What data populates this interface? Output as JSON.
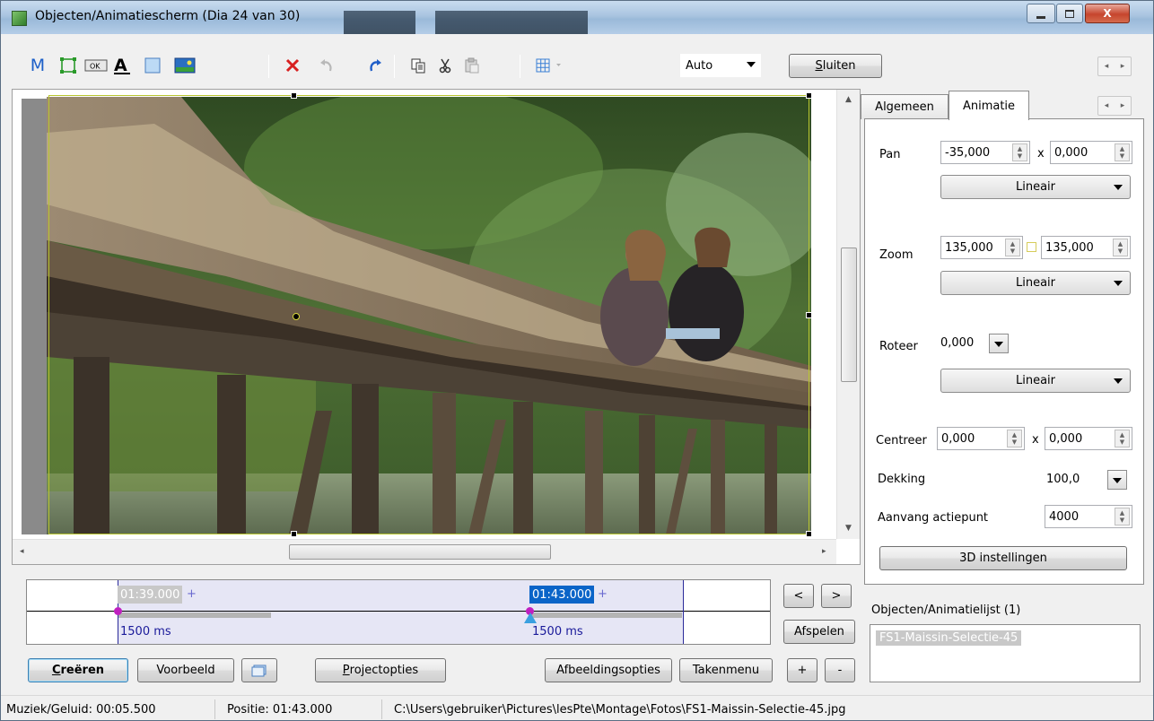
{
  "window": {
    "title": "Objecten/Animatiescherm  (Dia 24 van 30)",
    "min_icon": "minimize-icon",
    "max_icon": "maximize-icon",
    "close_icon": "close-icon",
    "close_symbol": "X"
  },
  "toolbar": {
    "m_label": "M",
    "mode_value": "Auto",
    "close_button": "Sluiten",
    "close_accel": "S",
    "close_rest": "luiten"
  },
  "canvas": {
    "image_description": "photo"
  },
  "timeline": {
    "key1_time": "01:39.000",
    "key2_time": "01:43.000",
    "plus": "+",
    "key1_ms": "1500 ms",
    "key2_ms": "1500 ms"
  },
  "buttons": {
    "prev": "<",
    "next": ">",
    "play": "Afspelen",
    "add": "+",
    "remove": "-",
    "create_accel": "C",
    "create_rest": "reëren",
    "preview": "Voorbeeld",
    "project_accel": "P",
    "project_rest": "rojectopties",
    "image_options": "Afbeeldingsopties",
    "task_menu": "Takenmenu"
  },
  "tabs": {
    "general": "Algemeen",
    "animation": "Animatie"
  },
  "animation_panel": {
    "pan_label": "Pan",
    "pan_x": "-35,000",
    "pan_y": "0,000",
    "x_sep": "x",
    "pan_interp": "Lineair",
    "zoom_label": "Zoom",
    "zoom_x": "135,000",
    "zoom_y": "135,000",
    "zoom_interp": "Lineair",
    "rotate_label": "Roteer",
    "rotate_value": "0,000",
    "rotate_interp": "Lineair",
    "center_label": "Centreer",
    "center_x": "0,000",
    "center_y": "0,000",
    "opacity_label": "Dekking",
    "opacity_value": "100,0",
    "start_label": "Aanvang actiepunt",
    "start_value": "4000",
    "settings_3d": "3D instellingen"
  },
  "object_list": {
    "title": "Objecten/Animatielijst (1)",
    "items": [
      "FS1-Maissin-Selectie-45"
    ]
  },
  "status": {
    "music": "Muziek/Geluid: 00:05.500",
    "position": "Positie: 01:43.000",
    "path": "C:\\Users\\gebruiker\\Pictures\\lesPte\\Montage\\Fotos\\FS1-Maissin-Selectie-45.jpg"
  },
  "colors": {
    "accent": "#0a64c8",
    "selection_frame": "#b9c62f",
    "keyframe": "#c020c0"
  }
}
